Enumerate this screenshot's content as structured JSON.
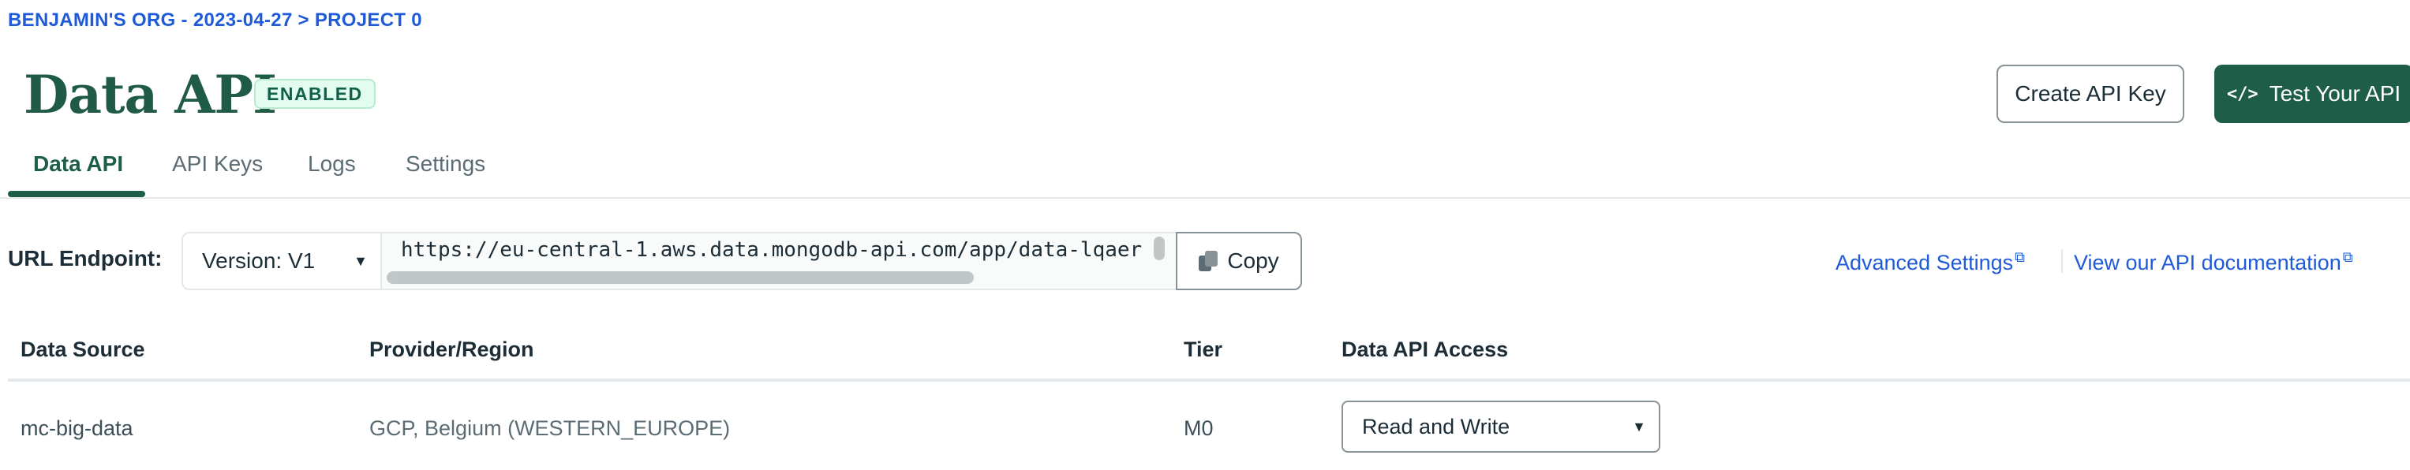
{
  "breadcrumb": "BENJAMIN'S ORG - 2023-04-27 > PROJECT 0",
  "header": {
    "title": "Data API",
    "status_badge": "ENABLED",
    "create_key_label": "Create API Key",
    "test_api_icon": "</>",
    "test_api_label": "Test Your API"
  },
  "tabs": [
    {
      "label": "Data API",
      "active": true
    },
    {
      "label": "API Keys",
      "active": false
    },
    {
      "label": "Logs",
      "active": false
    },
    {
      "label": "Settings",
      "active": false
    }
  ],
  "endpoint": {
    "label": "URL Endpoint:",
    "version_selected": "Version: V1",
    "url": "https://eu-central-1.aws.data.mongodb-api.com/app/data-lqaer",
    "copy_label": "Copy"
  },
  "links": {
    "advanced_settings": "Advanced Settings",
    "api_docs": "View our API documentation"
  },
  "table": {
    "columns": [
      "Data Source",
      "Provider/Region",
      "Tier",
      "Data API Access"
    ],
    "rows": [
      {
        "data_source": "mc-big-data",
        "provider_region": "GCP, Belgium (WESTERN_EUROPE)",
        "tier": "M0",
        "access": "Read and Write"
      }
    ]
  },
  "colors": {
    "brand_green": "#1e5d48",
    "link_blue": "#1f5bd8",
    "badge_bg": "#e3fcf0"
  },
  "icons": [
    "caret-down-icon",
    "copy-icon",
    "external-link-icon",
    "code-icon"
  ]
}
